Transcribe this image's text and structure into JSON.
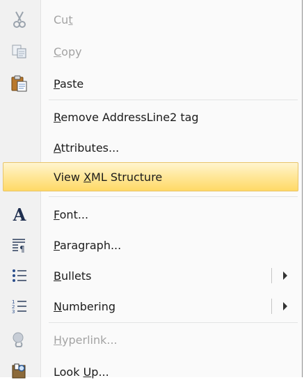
{
  "menu": {
    "items": [
      {
        "pre": "Cu",
        "mn": "t",
        "post": "",
        "icon": "scissors-icon"
      },
      {
        "pre": "",
        "mn": "C",
        "post": "opy",
        "icon": "copy-icon"
      },
      {
        "pre": "",
        "mn": "P",
        "post": "aste",
        "icon": "paste-icon"
      },
      {
        "pre": "",
        "mn": "R",
        "post": "emove AddressLine2 tag"
      },
      {
        "pre": "",
        "mn": "A",
        "post": "ttributes..."
      },
      {
        "pre": "View ",
        "mn": "X",
        "post": "ML Structure"
      },
      {
        "pre": "",
        "mn": "F",
        "post": "ont...",
        "icon": "font-icon"
      },
      {
        "pre": "",
        "mn": "P",
        "post": "aragraph...",
        "icon": "paragraph-icon"
      },
      {
        "pre": "",
        "mn": "B",
        "post": "ullets",
        "icon": "bullets-icon"
      },
      {
        "pre": "",
        "mn": "N",
        "post": "umbering",
        "icon": "numbering-icon"
      },
      {
        "pre": "",
        "mn": "H",
        "post": "yperlink...",
        "icon": "hyperlink-icon"
      },
      {
        "pre": "Look ",
        "mn": "U",
        "post": "p...",
        "icon": "look-up-icon"
      }
    ]
  },
  "colors": {
    "highlight": "#ffe89d",
    "disabled_text": "#a3a3a3",
    "gutter": "#f1f1f1"
  }
}
